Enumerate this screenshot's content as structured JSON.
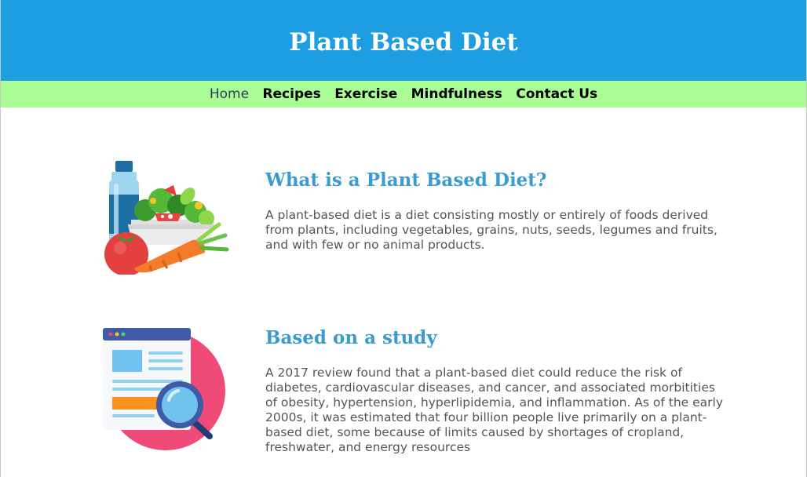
{
  "header": {
    "title": "Plant Based Diet",
    "background": "#1d9de2"
  },
  "nav": {
    "background": "#aafc94",
    "items": [
      {
        "label": "Home",
        "active": true
      },
      {
        "label": "Recipes",
        "active": false
      },
      {
        "label": "Exercise",
        "active": false
      },
      {
        "label": "Mindfulness",
        "active": false
      },
      {
        "label": "Contact Us",
        "active": false
      }
    ]
  },
  "sections": [
    {
      "icon": "food-bowl-bottle-illustration",
      "heading": "What is a Plant Based Diet?",
      "text": "A plant-based diet is a diet consisting mostly or entirely of foods derived from plants, including vegetables, grains, nuts, seeds, legumes and fruits, and with few or no animal products."
    },
    {
      "icon": "research-magnifier-illustration",
      "heading": "Based on a study",
      "text": "A 2017 review found that a plant-based diet could reduce the risk of diabetes, cardiovascular diseases, and cancer, and associated morbitities of obesity, hypertension, hyperlipidemia, and inflammation. As of the early 2000s, it was estimated that four billion people live primarily on a plant-based diet, some because of limits caused by shortages of cropland, freshwater, and energy resources"
    }
  ],
  "colors": {
    "heading": "#3a9bd0",
    "body_text": "#555555"
  }
}
